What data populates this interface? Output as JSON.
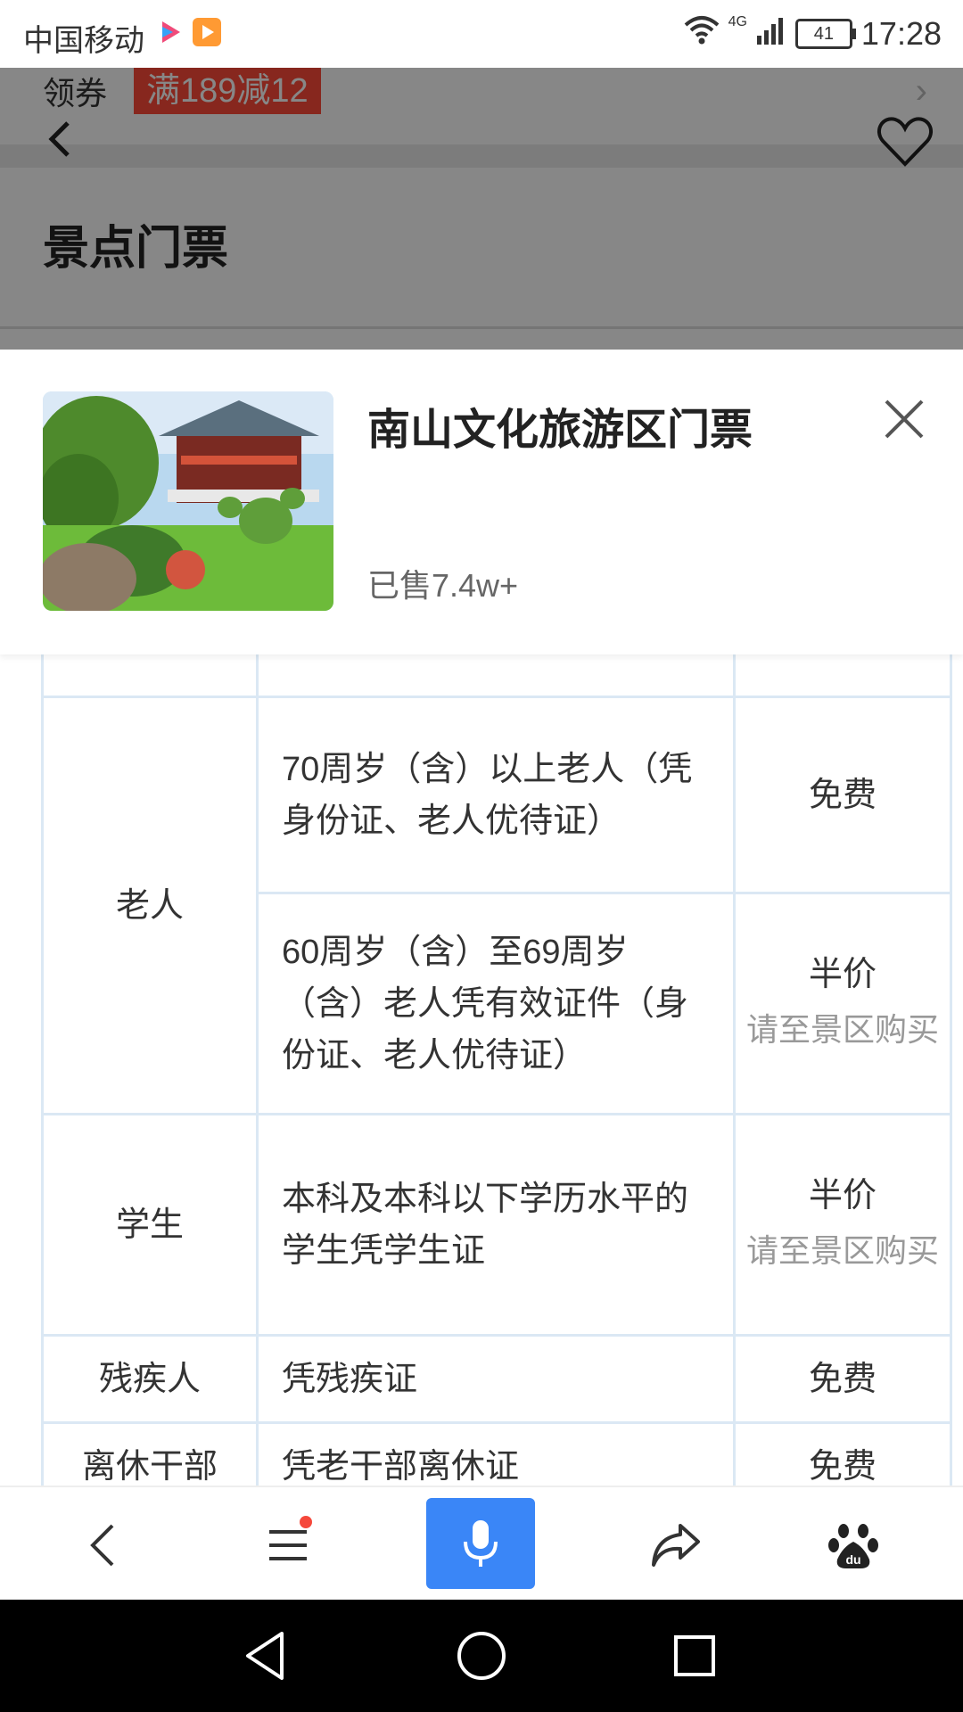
{
  "status_bar": {
    "carrier": "中国移动",
    "network": "4G",
    "battery": "41",
    "time": "17:28"
  },
  "background_page": {
    "coupon_label": "领券",
    "coupon_tag": "满189减12",
    "section_title": "景点门票"
  },
  "product": {
    "title": "南山文化旅游区门票",
    "sold": "已售7.4w+"
  },
  "ticket_table": {
    "rows": [
      {
        "category": "",
        "desc": "",
        "price": "",
        "note": ""
      },
      {
        "category": "老人",
        "desc": "70周岁（含）以上老人（凭身份证、老人优待证）",
        "price": "免费",
        "note": ""
      },
      {
        "category": "",
        "desc": "60周岁（含）至69周岁（含）老人凭有效证件（身份证、老人优待证）",
        "price": "半价",
        "note": "请至景区购买"
      },
      {
        "category": "学生",
        "desc": "本科及本科以下学历水平的学生凭学生证",
        "price": "半价",
        "note": "请至景区购买"
      },
      {
        "category": "残疾人",
        "desc": "凭残疾证",
        "price": "免费",
        "note": ""
      },
      {
        "category": "离休干部",
        "desc": "凭老干部离休证",
        "price": "免费",
        "note": ""
      }
    ]
  },
  "colors": {
    "accent_blue": "#3a86f7",
    "coupon_red": "#ff4b3a",
    "table_border": "#dbe8f4"
  }
}
